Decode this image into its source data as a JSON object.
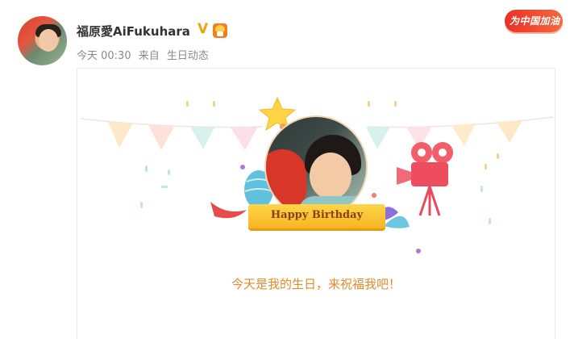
{
  "post": {
    "username": "福原愛AiFukuhara",
    "verified_icon": "verified-v-icon",
    "medal_icon": "birthday-medal-icon",
    "time": "今天 00:30",
    "source_prefix": "来自",
    "source": "生日动态"
  },
  "promo": {
    "label": "为中国加油"
  },
  "card": {
    "banner_text": "Happy Birthday",
    "message": "今天是我的生日，来祝福我吧！",
    "colors": {
      "message": "#e58a2b",
      "ribbon": "#f7b523"
    }
  }
}
